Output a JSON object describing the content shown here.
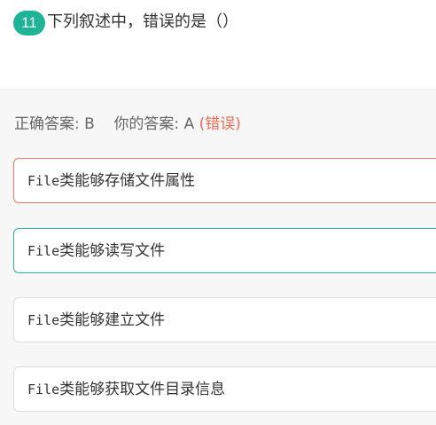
{
  "question": {
    "number": "11",
    "text": "下列叙述中，错误的是（）"
  },
  "answer": {
    "correct_label": "正确答案:",
    "correct_value": "B",
    "yours_label": "你的答案:",
    "yours_value": "A",
    "verdict": "(错误)"
  },
  "options": [
    {
      "prefix": "File",
      "text": "类能够存储文件属性",
      "state": "selected-wrong"
    },
    {
      "prefix": "File",
      "text": "类能够读写文件",
      "state": "correct"
    },
    {
      "prefix": "File",
      "text": "类能够建立文件",
      "state": "normal"
    },
    {
      "prefix": "File",
      "text": "类能够获取文件目录信息",
      "state": "normal"
    }
  ],
  "colors": {
    "badge": "#1fb397",
    "wrong": "#ee6b53",
    "correct_border": "#2ab59a",
    "wrong_border": "#ea7a64"
  }
}
